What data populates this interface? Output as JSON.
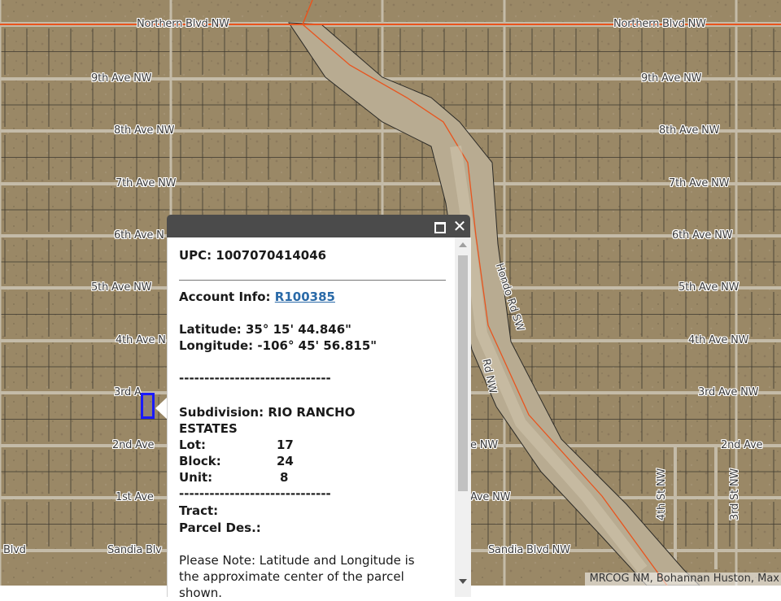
{
  "map": {
    "street_labels": [
      {
        "key": "northern-left",
        "text": "Northern Blvd NW"
      },
      {
        "key": "northern-right",
        "text": "Northern Blvd NW"
      },
      {
        "key": "ave9-left",
        "text": "9th Ave NW"
      },
      {
        "key": "ave9-right",
        "text": "9th Ave NW"
      },
      {
        "key": "ave8-left",
        "text": "8th Ave NW"
      },
      {
        "key": "ave8-right",
        "text": "8th Ave NW"
      },
      {
        "key": "ave7-left",
        "text": "7th Ave NW"
      },
      {
        "key": "ave7-right",
        "text": "7th Ave NW"
      },
      {
        "key": "ave6-left",
        "text": "6th Ave N"
      },
      {
        "key": "ave6-right",
        "text": "6th Ave NW"
      },
      {
        "key": "ave5-left",
        "text": "5th Ave NW"
      },
      {
        "key": "ave5-right",
        "text": "5th Ave NW"
      },
      {
        "key": "ave4-left",
        "text": "4th Ave N"
      },
      {
        "key": "ave4-right",
        "text": "4th Ave NW"
      },
      {
        "key": "ave3-left",
        "text": "3rd A"
      },
      {
        "key": "ave3-right",
        "text": "3rd Ave NW"
      },
      {
        "key": "ave2-left",
        "text": "2nd Ave"
      },
      {
        "key": "ave2-mid",
        "text": "e NW"
      },
      {
        "key": "ave2-right",
        "text": "2nd Ave"
      },
      {
        "key": "ave1-left",
        "text": "1st Ave"
      },
      {
        "key": "ave1-mid",
        "text": "Ave NW"
      },
      {
        "key": "sandia-left",
        "text": "Sandia Blv"
      },
      {
        "key": "sandia-right",
        "text": "Sandia Blvd NW"
      },
      {
        "key": "sandia-far-left",
        "text": "Blvd"
      },
      {
        "key": "hondo",
        "text": "Hondo Rd SW"
      },
      {
        "key": "rd-nw",
        "text": "Rd NW"
      },
      {
        "key": "st4",
        "text": "4th St NW"
      },
      {
        "key": "st3",
        "text": "3rd St NW"
      }
    ],
    "attribution": "MRCOG NM, Bohannan Huston, Max",
    "colors": {
      "ground": "#9c8a6a",
      "parcel_line": "#2a2a2a",
      "road": "#bcb3a0",
      "boundary": "#e8541e",
      "selection": "#1a1aff"
    }
  },
  "popup": {
    "maximize_icon": "maximize-icon",
    "close_icon": "close-icon",
    "upc_label": "UPC:",
    "upc_value": "1007070414046",
    "account_label": "Account Info:",
    "account_value": "R100385",
    "latitude_label": "Latitude:",
    "latitude_value": "35° 15' 44.846\"",
    "longitude_label": "Longitude:",
    "longitude_value": "-106° 45' 56.815\"",
    "divider_1": "------------------------------",
    "subdivision_label": "Subdivision:",
    "subdivision_value_1": "RIO RANCHO",
    "subdivision_value_2": "ESTATES",
    "lot_label": "Lot:",
    "lot_value": "17",
    "block_label": "Block:",
    "block_value": "24",
    "unit_label": "Unit:",
    "unit_value": "8",
    "divider_2": "------------------------------",
    "tract_label": "Tract:",
    "parcel_des_label": "Parcel Des.:",
    "note_line_1": "Please Note: Latitude and Longitude is",
    "note_line_2": "the approximate center of the parcel",
    "note_line_3": "shown."
  }
}
